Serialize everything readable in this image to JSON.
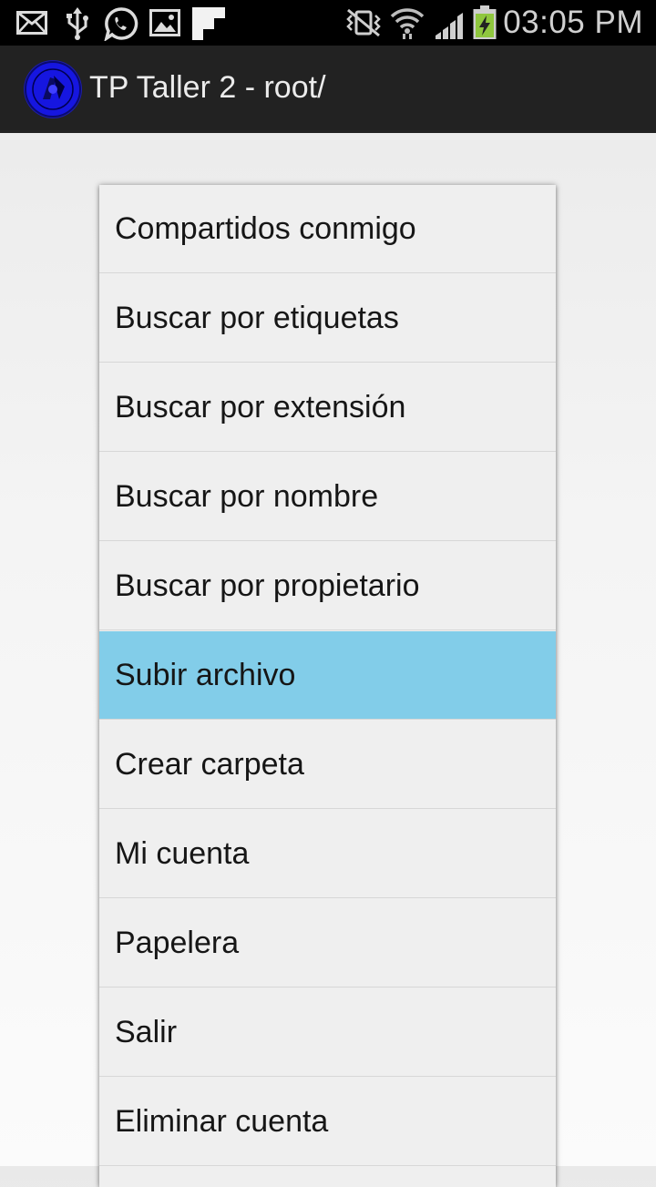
{
  "status_bar": {
    "time": "03:05 PM",
    "icons": [
      "mail-icon",
      "usb-icon",
      "whatsapp-icon",
      "gallery-icon",
      "flipboard-icon",
      "vibrate-icon",
      "wifi-icon",
      "signal-icon",
      "battery-charging-icon"
    ]
  },
  "action_bar": {
    "title": "TP Taller 2 - root/",
    "logo_icon": "app-logo-icon"
  },
  "menu": {
    "items": [
      {
        "label": "Compartidos conmigo"
      },
      {
        "label": "Buscar por etiquetas"
      },
      {
        "label": "Buscar por extensión"
      },
      {
        "label": "Buscar por nombre"
      },
      {
        "label": "Buscar por propietario"
      },
      {
        "label": "Subir archivo",
        "highlighted": true
      },
      {
        "label": "Crear carpeta"
      },
      {
        "label": "Mi cuenta"
      },
      {
        "label": "Papelera"
      },
      {
        "label": "Salir"
      },
      {
        "label": "Eliminar cuenta"
      }
    ]
  },
  "colors": {
    "highlight": "#82cde9",
    "action_bar": "#222222",
    "status_bar": "#000000",
    "battery_green": "#8fc73e"
  }
}
